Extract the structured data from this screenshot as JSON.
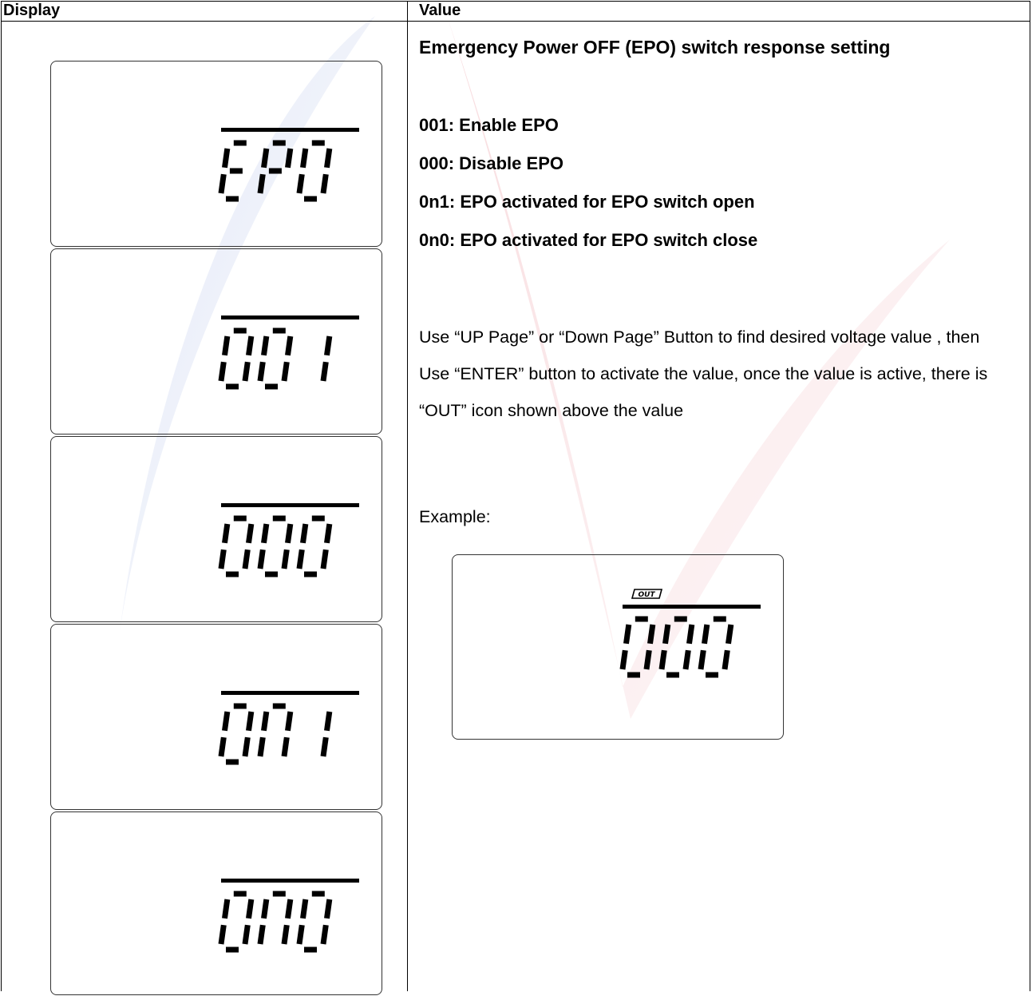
{
  "header": {
    "display_col": "Display",
    "value_col": "Value"
  },
  "lcd_rows": [
    {
      "code": "EPO"
    },
    {
      "code": "001"
    },
    {
      "code": "000"
    },
    {
      "code": "0n1"
    },
    {
      "code": "0n0"
    }
  ],
  "value": {
    "title": "Emergency Power OFF (EPO) switch response setting",
    "options": [
      "001:  Enable EPO",
      "000:  Disable EPO",
      "0n1:  EPO activated for EPO switch open",
      "0n0:  EPO activated for EPO switch close"
    ],
    "instructions": "Use “UP Page” or “Down Page” Button to find desired voltage value , then Use “ENTER” button to activate the value,  once the value is active, there is “OUT” icon shown above the value",
    "example_label": "Example:",
    "example_lcd": {
      "icon_text": "OUT",
      "code": "000"
    }
  },
  "colors": {
    "watermark_blue": "#c8d2ee",
    "watermark_red": "#f4c8cc",
    "segment": "#000000"
  }
}
